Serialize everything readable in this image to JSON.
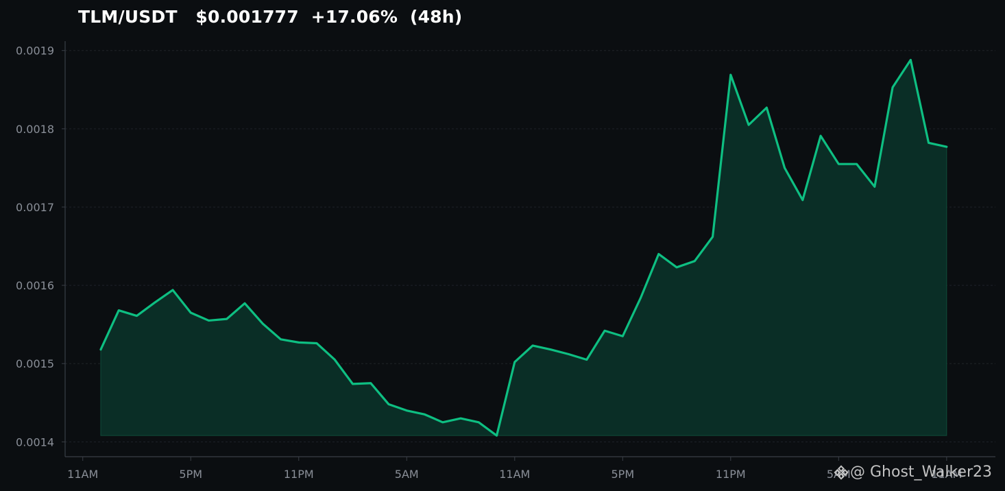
{
  "title": "TLM/USDT   $0.001777  +17.06%  (48h)",
  "watermark": {
    "text": "@ Ghost_Walker23",
    "icon": "binance-logo-icon"
  },
  "colors": {
    "background": "#0b0e11",
    "line": "#0ebf82",
    "fill": "#0a2e26",
    "grid": "#1f2329",
    "axis": "#3a3f47",
    "tick_text": "#8a8f98"
  },
  "chart_data": {
    "type": "area",
    "title": "TLM/USDT   $0.001777  +17.06%  (48h)",
    "xlabel": "",
    "ylabel": "",
    "x_ticks": [
      {
        "label": "11AM",
        "index": -1
      },
      {
        "label": "5PM",
        "index": 5
      },
      {
        "label": "11PM",
        "index": 11
      },
      {
        "label": "5AM",
        "index": 17
      },
      {
        "label": "11AM",
        "index": 23
      },
      {
        "label": "5PM",
        "index": 29
      },
      {
        "label": "11PM",
        "index": 35
      },
      {
        "label": "5AM",
        "index": 41
      },
      {
        "label": "11AM",
        "index": 47
      }
    ],
    "y_ticks": [
      0.0014,
      0.0015,
      0.0016,
      0.0017,
      0.0018,
      0.0019
    ],
    "y_tick_labels": [
      "0.0014",
      "0.0015",
      "0.0016",
      "0.0017",
      "0.0018",
      "0.0019"
    ],
    "ylim": [
      0.001381,
      0.001912
    ],
    "xlim": [
      -1.98,
      49.71
    ],
    "grid": true,
    "series": [
      {
        "values": [
          0.001518,
          0.001568,
          0.001561,
          0.001578,
          0.001594,
          0.001565,
          0.001555,
          0.001557,
          0.001577,
          0.001551,
          0.001531,
          0.001527,
          0.001526,
          0.001505,
          0.001474,
          0.001475,
          0.001448,
          0.00144,
          0.001435,
          0.001425,
          0.00143,
          0.001425,
          0.001408,
          0.001502,
          0.001523,
          0.001518,
          0.001512,
          0.001505,
          0.001542,
          0.001535,
          0.001584,
          0.00164,
          0.001623,
          0.001631,
          0.001662,
          0.001869,
          0.001805,
          0.001827,
          0.00175,
          0.001709,
          0.001791,
          0.001755,
          0.001755,
          0.001726,
          0.001853,
          0.001888,
          0.001782,
          0.001777
        ]
      }
    ]
  }
}
